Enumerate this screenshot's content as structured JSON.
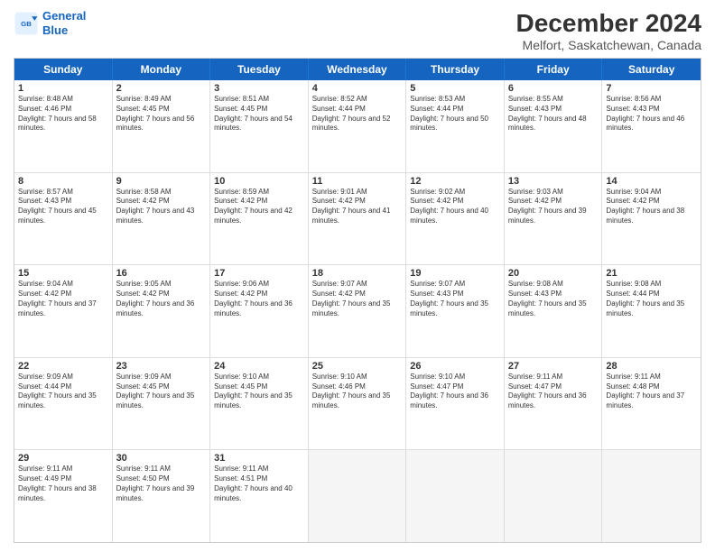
{
  "header": {
    "logo_line1": "General",
    "logo_line2": "Blue",
    "title": "December 2024",
    "subtitle": "Melfort, Saskatchewan, Canada"
  },
  "days": [
    "Sunday",
    "Monday",
    "Tuesday",
    "Wednesday",
    "Thursday",
    "Friday",
    "Saturday"
  ],
  "rows": [
    [
      {
        "day": "1",
        "sunrise": "8:48 AM",
        "sunset": "4:46 PM",
        "daylight": "7 hours and 58 minutes."
      },
      {
        "day": "2",
        "sunrise": "8:49 AM",
        "sunset": "4:45 PM",
        "daylight": "7 hours and 56 minutes."
      },
      {
        "day": "3",
        "sunrise": "8:51 AM",
        "sunset": "4:45 PM",
        "daylight": "7 hours and 54 minutes."
      },
      {
        "day": "4",
        "sunrise": "8:52 AM",
        "sunset": "4:44 PM",
        "daylight": "7 hours and 52 minutes."
      },
      {
        "day": "5",
        "sunrise": "8:53 AM",
        "sunset": "4:44 PM",
        "daylight": "7 hours and 50 minutes."
      },
      {
        "day": "6",
        "sunrise": "8:55 AM",
        "sunset": "4:43 PM",
        "daylight": "7 hours and 48 minutes."
      },
      {
        "day": "7",
        "sunrise": "8:56 AM",
        "sunset": "4:43 PM",
        "daylight": "7 hours and 46 minutes."
      }
    ],
    [
      {
        "day": "8",
        "sunrise": "8:57 AM",
        "sunset": "4:43 PM",
        "daylight": "7 hours and 45 minutes."
      },
      {
        "day": "9",
        "sunrise": "8:58 AM",
        "sunset": "4:42 PM",
        "daylight": "7 hours and 43 minutes."
      },
      {
        "day": "10",
        "sunrise": "8:59 AM",
        "sunset": "4:42 PM",
        "daylight": "7 hours and 42 minutes."
      },
      {
        "day": "11",
        "sunrise": "9:01 AM",
        "sunset": "4:42 PM",
        "daylight": "7 hours and 41 minutes."
      },
      {
        "day": "12",
        "sunrise": "9:02 AM",
        "sunset": "4:42 PM",
        "daylight": "7 hours and 40 minutes."
      },
      {
        "day": "13",
        "sunrise": "9:03 AM",
        "sunset": "4:42 PM",
        "daylight": "7 hours and 39 minutes."
      },
      {
        "day": "14",
        "sunrise": "9:04 AM",
        "sunset": "4:42 PM",
        "daylight": "7 hours and 38 minutes."
      }
    ],
    [
      {
        "day": "15",
        "sunrise": "9:04 AM",
        "sunset": "4:42 PM",
        "daylight": "7 hours and 37 minutes."
      },
      {
        "day": "16",
        "sunrise": "9:05 AM",
        "sunset": "4:42 PM",
        "daylight": "7 hours and 36 minutes."
      },
      {
        "day": "17",
        "sunrise": "9:06 AM",
        "sunset": "4:42 PM",
        "daylight": "7 hours and 36 minutes."
      },
      {
        "day": "18",
        "sunrise": "9:07 AM",
        "sunset": "4:42 PM",
        "daylight": "7 hours and 35 minutes."
      },
      {
        "day": "19",
        "sunrise": "9:07 AM",
        "sunset": "4:43 PM",
        "daylight": "7 hours and 35 minutes."
      },
      {
        "day": "20",
        "sunrise": "9:08 AM",
        "sunset": "4:43 PM",
        "daylight": "7 hours and 35 minutes."
      },
      {
        "day": "21",
        "sunrise": "9:08 AM",
        "sunset": "4:44 PM",
        "daylight": "7 hours and 35 minutes."
      }
    ],
    [
      {
        "day": "22",
        "sunrise": "9:09 AM",
        "sunset": "4:44 PM",
        "daylight": "7 hours and 35 minutes."
      },
      {
        "day": "23",
        "sunrise": "9:09 AM",
        "sunset": "4:45 PM",
        "daylight": "7 hours and 35 minutes."
      },
      {
        "day": "24",
        "sunrise": "9:10 AM",
        "sunset": "4:45 PM",
        "daylight": "7 hours and 35 minutes."
      },
      {
        "day": "25",
        "sunrise": "9:10 AM",
        "sunset": "4:46 PM",
        "daylight": "7 hours and 35 minutes."
      },
      {
        "day": "26",
        "sunrise": "9:10 AM",
        "sunset": "4:47 PM",
        "daylight": "7 hours and 36 minutes."
      },
      {
        "day": "27",
        "sunrise": "9:11 AM",
        "sunset": "4:47 PM",
        "daylight": "7 hours and 36 minutes."
      },
      {
        "day": "28",
        "sunrise": "9:11 AM",
        "sunset": "4:48 PM",
        "daylight": "7 hours and 37 minutes."
      }
    ],
    [
      {
        "day": "29",
        "sunrise": "9:11 AM",
        "sunset": "4:49 PM",
        "daylight": "7 hours and 38 minutes."
      },
      {
        "day": "30",
        "sunrise": "9:11 AM",
        "sunset": "4:50 PM",
        "daylight": "7 hours and 39 minutes."
      },
      {
        "day": "31",
        "sunrise": "9:11 AM",
        "sunset": "4:51 PM",
        "daylight": "7 hours and 40 minutes."
      },
      null,
      null,
      null,
      null
    ]
  ]
}
